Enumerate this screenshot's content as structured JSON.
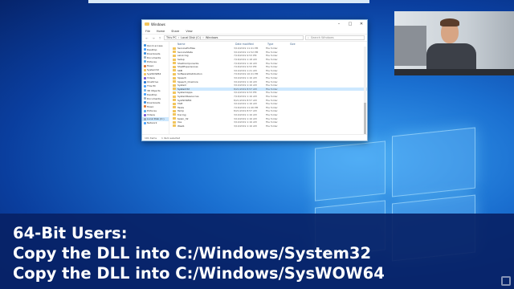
{
  "explorer": {
    "title": "Windows",
    "ribbon_tabs": [
      "File",
      "Home",
      "Share",
      "View"
    ],
    "breadcrumb": [
      "This PC",
      "Local Disk (C:)",
      "Windows"
    ],
    "search_placeholder": "Search Windows",
    "columns": {
      "name": "Name",
      "date": "Date modified",
      "type": "Type",
      "size": "Size"
    },
    "nav_items": [
      {
        "label": "Quick access",
        "color": "#3b8fe0"
      },
      {
        "label": "Desktop",
        "color": "#4aa3ff"
      },
      {
        "label": "Downloads",
        "color": "#3b8fe0"
      },
      {
        "label": "Documents",
        "color": "#9ab3c8"
      },
      {
        "label": "Pictures",
        "color": "#5bb0ef"
      },
      {
        "label": "Music",
        "color": "#e07a3b"
      },
      {
        "label": "System32",
        "color": "#f2c55c"
      },
      {
        "label": "SysWOW64",
        "color": "#f2c55c"
      },
      {
        "label": "Videos",
        "color": "#7a5bd6"
      },
      {
        "label": "OneDrive",
        "color": "#2b7bd8"
      },
      {
        "label": "This PC",
        "color": "#4aa3ff"
      },
      {
        "label": "3D Objects",
        "color": "#6fb6f0"
      },
      {
        "label": "Desktop",
        "color": "#4aa3ff"
      },
      {
        "label": "Documents",
        "color": "#9ab3c8"
      },
      {
        "label": "Downloads",
        "color": "#3b8fe0"
      },
      {
        "label": "Music",
        "color": "#e07a3b"
      },
      {
        "label": "Pictures",
        "color": "#5bb0ef"
      },
      {
        "label": "Videos",
        "color": "#7a5bd6"
      },
      {
        "label": "Local Disk (C:)",
        "color": "#9aa6b2"
      },
      {
        "label": "Network",
        "color": "#4aa3ff"
      }
    ],
    "rows": [
      {
        "name": "ServiceProfiles",
        "date": "3/19/2019 11:41 PM",
        "type": "File folder"
      },
      {
        "name": "ServiceState",
        "date": "3/19/2019 11:52 PM",
        "type": "File folder"
      },
      {
        "name": "servicing",
        "date": "7/18/2019 9:53 PM",
        "type": "File folder"
      },
      {
        "name": "Setup",
        "date": "7/18/2019 1:18 AM",
        "type": "File folder"
      },
      {
        "name": "ShellComponents",
        "date": "7/18/2019 1:16 AM",
        "type": "File folder"
      },
      {
        "name": "ShellExperiences",
        "date": "7/18/2019 9:53 PM",
        "type": "File folder"
      },
      {
        "name": "SKB",
        "date": "3/19/2019 1:21 AM",
        "type": "File folder"
      },
      {
        "name": "SoftwareDistribution",
        "date": "7/18/2019 10:41 PM",
        "type": "File folder"
      },
      {
        "name": "Speech",
        "date": "3/19/2019 1:16 AM",
        "type": "File folder"
      },
      {
        "name": "Speech_OneCore",
        "date": "3/19/2019 1:16 AM",
        "type": "File folder"
      },
      {
        "name": "System",
        "date": "3/19/2019 1:16 AM",
        "type": "File folder"
      },
      {
        "name": "System32",
        "date": "8/21/2019 8:57 AM",
        "type": "File folder",
        "selected": true
      },
      {
        "name": "SystemApps",
        "date": "3/19/2019 9:53 PM",
        "type": "File folder"
      },
      {
        "name": "SystemResources",
        "date": "7/18/2019 1:16 AM",
        "type": "File folder"
      },
      {
        "name": "SysWOW64",
        "date": "8/21/2019 8:57 AM",
        "type": "File folder"
      },
      {
        "name": "TAPI",
        "date": "3/19/2019 1:16 AM",
        "type": "File folder"
      },
      {
        "name": "Tasks",
        "date": "7/18/2019 11:46 PM",
        "type": "File folder"
      },
      {
        "name": "Temp",
        "date": "8/21/2019 8:57 AM",
        "type": "File folder"
      },
      {
        "name": "tracing",
        "date": "3/19/2019 1:16 AM",
        "type": "File folder"
      },
      {
        "name": "twain_32",
        "date": "3/19/2019 1:16 AM",
        "type": "File folder"
      },
      {
        "name": "Vss",
        "date": "3/19/2019 1:16 AM",
        "type": "File folder"
      },
      {
        "name": "WaaS",
        "date": "3/19/2019 1:16 AM",
        "type": "File folder"
      }
    ],
    "status_count": "101 items",
    "status_selected": "1 item selected"
  },
  "caption": {
    "line1": "64-Bit Users:",
    "line2": "Copy the DLL into C:/Windows/System32",
    "line3": "Copy the DLL into C:/Windows/SysWOW64"
  }
}
